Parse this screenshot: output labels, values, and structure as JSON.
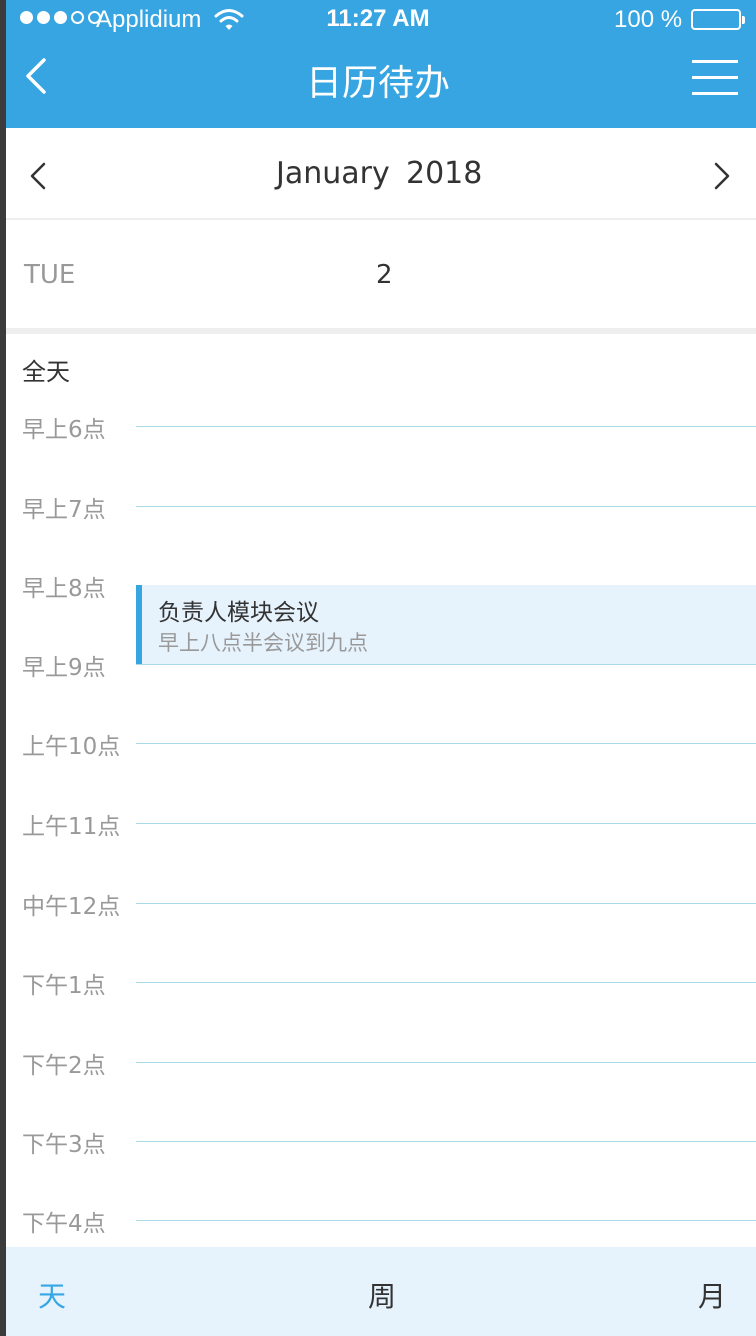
{
  "status_bar": {
    "carrier": "Applidium",
    "time": "11:27 AM",
    "battery": "100 %"
  },
  "header": {
    "title": "日历待办",
    "back_icon": "chevron-left-icon",
    "menu_icon": "hamburger-menu-icon"
  },
  "month_nav": {
    "month": "January",
    "year": "2018",
    "prev_icon": "chevron-left-icon",
    "next_icon": "chevron-right-icon"
  },
  "day": {
    "weekday": "TUE",
    "number": "2"
  },
  "all_day_label": "全天",
  "hours": [
    "早上6点",
    "早上7点",
    "早上8点",
    "早上9点",
    "上午10点",
    "上午11点",
    "中午12点",
    "下午1点",
    "下午2点",
    "下午3点",
    "下午4点"
  ],
  "event": {
    "title": "负责人模块会议",
    "subtitle": "早上八点半会议到九点"
  },
  "tabs": {
    "day": "天",
    "week": "周",
    "month": "月",
    "active": "day"
  },
  "colors": {
    "header_bg": "#36a5e2",
    "header_text": "#fffefe",
    "primary_text": "#333333",
    "active_tab": "#36a7e3",
    "secondary_text": "#999999",
    "grid_line": "#a8dcea",
    "event_bg": "#e6f3fd"
  }
}
